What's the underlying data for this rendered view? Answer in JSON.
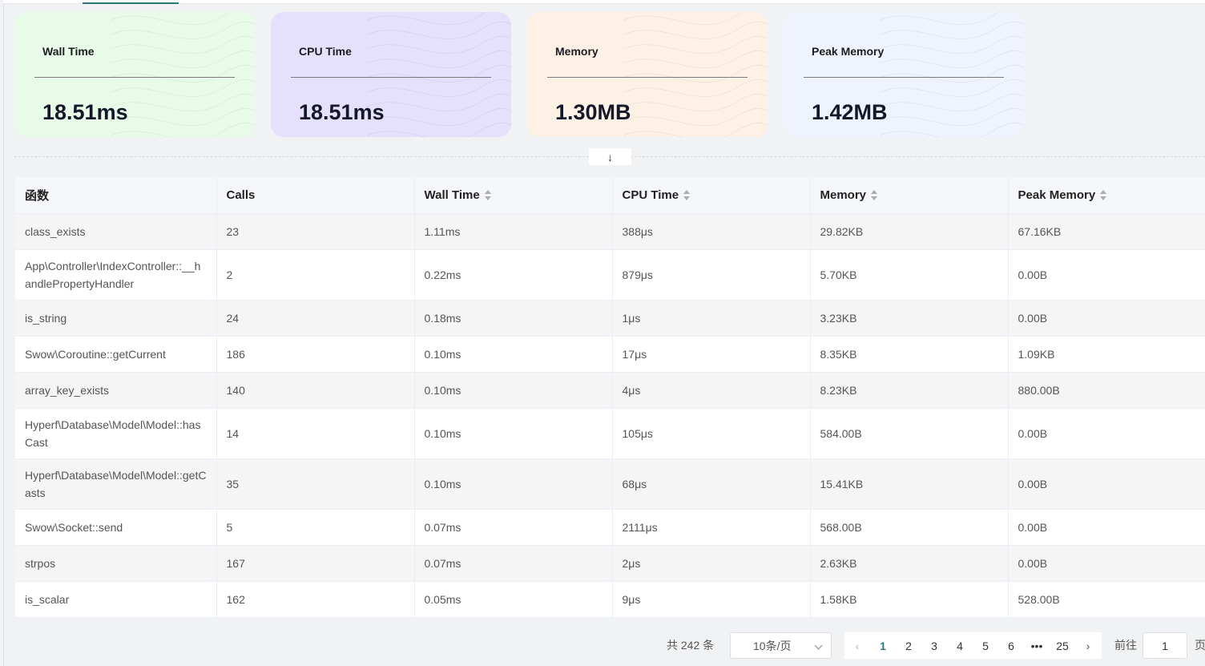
{
  "cards": [
    {
      "label": "Wall Time",
      "value": "18.51ms",
      "color": "#e8fbe9"
    },
    {
      "label": "CPU Time",
      "value": "18.51ms",
      "color": "#e5e0fb"
    },
    {
      "label": "Memory",
      "value": "1.30MB",
      "color": "#fdf1e6"
    },
    {
      "label": "Peak Memory",
      "value": "1.42MB",
      "color": "#eef3fd"
    }
  ],
  "expand_icon": "↓",
  "table": {
    "headers": [
      "函数",
      "Calls",
      "Wall Time",
      "CPU Time",
      "Memory",
      "Peak Memory"
    ],
    "rows": [
      [
        "class_exists",
        "23",
        "1.11ms",
        "388μs",
        "29.82KB",
        "67.16KB"
      ],
      [
        "App\\Controller\\IndexController::__handlePropertyHandler",
        "2",
        "0.22ms",
        "879μs",
        "5.70KB",
        "0.00B"
      ],
      [
        "is_string",
        "24",
        "0.18ms",
        "1μs",
        "3.23KB",
        "0.00B"
      ],
      [
        "Swow\\Coroutine::getCurrent",
        "186",
        "0.10ms",
        "17μs",
        "8.35KB",
        "1.09KB"
      ],
      [
        "array_key_exists",
        "140",
        "0.10ms",
        "4μs",
        "8.23KB",
        "880.00B"
      ],
      [
        "Hyperf\\Database\\Model\\Model::hasCast",
        "14",
        "0.10ms",
        "105μs",
        "584.00B",
        "0.00B"
      ],
      [
        "Hyperf\\Database\\Model\\Model::getCasts",
        "35",
        "0.10ms",
        "68μs",
        "15.41KB",
        "0.00B"
      ],
      [
        "Swow\\Socket::send",
        "5",
        "0.07ms",
        "2111μs",
        "568.00B",
        "0.00B"
      ],
      [
        "strpos",
        "167",
        "0.07ms",
        "2μs",
        "2.63KB",
        "0.00B"
      ],
      [
        "is_scalar",
        "162",
        "0.05ms",
        "9μs",
        "1.58KB",
        "528.00B"
      ]
    ]
  },
  "pagination": {
    "total_text": "共 242 条",
    "page_size": "10条/页",
    "pages": [
      "1",
      "2",
      "3",
      "4",
      "5",
      "6",
      "•••",
      "25"
    ],
    "current_page": "1",
    "prev_icon": "‹",
    "next_icon": "›",
    "goto_label": "前往",
    "goto_value": "1",
    "goto_suffix": "页"
  }
}
